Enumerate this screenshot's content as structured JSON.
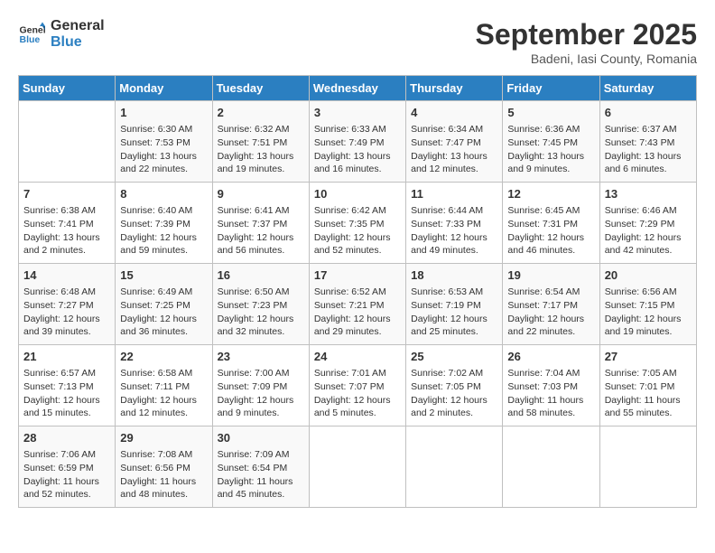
{
  "header": {
    "logo": {
      "line1": "General",
      "line2": "Blue"
    },
    "month": "September 2025",
    "location": "Badeni, Iasi County, Romania"
  },
  "weekdays": [
    "Sunday",
    "Monday",
    "Tuesday",
    "Wednesday",
    "Thursday",
    "Friday",
    "Saturday"
  ],
  "weeks": [
    [
      {
        "day": "",
        "info": ""
      },
      {
        "day": "1",
        "info": "Sunrise: 6:30 AM\nSunset: 7:53 PM\nDaylight: 13 hours\nand 22 minutes."
      },
      {
        "day": "2",
        "info": "Sunrise: 6:32 AM\nSunset: 7:51 PM\nDaylight: 13 hours\nand 19 minutes."
      },
      {
        "day": "3",
        "info": "Sunrise: 6:33 AM\nSunset: 7:49 PM\nDaylight: 13 hours\nand 16 minutes."
      },
      {
        "day": "4",
        "info": "Sunrise: 6:34 AM\nSunset: 7:47 PM\nDaylight: 13 hours\nand 12 minutes."
      },
      {
        "day": "5",
        "info": "Sunrise: 6:36 AM\nSunset: 7:45 PM\nDaylight: 13 hours\nand 9 minutes."
      },
      {
        "day": "6",
        "info": "Sunrise: 6:37 AM\nSunset: 7:43 PM\nDaylight: 13 hours\nand 6 minutes."
      }
    ],
    [
      {
        "day": "7",
        "info": "Sunrise: 6:38 AM\nSunset: 7:41 PM\nDaylight: 13 hours\nand 2 minutes."
      },
      {
        "day": "8",
        "info": "Sunrise: 6:40 AM\nSunset: 7:39 PM\nDaylight: 12 hours\nand 59 minutes."
      },
      {
        "day": "9",
        "info": "Sunrise: 6:41 AM\nSunset: 7:37 PM\nDaylight: 12 hours\nand 56 minutes."
      },
      {
        "day": "10",
        "info": "Sunrise: 6:42 AM\nSunset: 7:35 PM\nDaylight: 12 hours\nand 52 minutes."
      },
      {
        "day": "11",
        "info": "Sunrise: 6:44 AM\nSunset: 7:33 PM\nDaylight: 12 hours\nand 49 minutes."
      },
      {
        "day": "12",
        "info": "Sunrise: 6:45 AM\nSunset: 7:31 PM\nDaylight: 12 hours\nand 46 minutes."
      },
      {
        "day": "13",
        "info": "Sunrise: 6:46 AM\nSunset: 7:29 PM\nDaylight: 12 hours\nand 42 minutes."
      }
    ],
    [
      {
        "day": "14",
        "info": "Sunrise: 6:48 AM\nSunset: 7:27 PM\nDaylight: 12 hours\nand 39 minutes."
      },
      {
        "day": "15",
        "info": "Sunrise: 6:49 AM\nSunset: 7:25 PM\nDaylight: 12 hours\nand 36 minutes."
      },
      {
        "day": "16",
        "info": "Sunrise: 6:50 AM\nSunset: 7:23 PM\nDaylight: 12 hours\nand 32 minutes."
      },
      {
        "day": "17",
        "info": "Sunrise: 6:52 AM\nSunset: 7:21 PM\nDaylight: 12 hours\nand 29 minutes."
      },
      {
        "day": "18",
        "info": "Sunrise: 6:53 AM\nSunset: 7:19 PM\nDaylight: 12 hours\nand 25 minutes."
      },
      {
        "day": "19",
        "info": "Sunrise: 6:54 AM\nSunset: 7:17 PM\nDaylight: 12 hours\nand 22 minutes."
      },
      {
        "day": "20",
        "info": "Sunrise: 6:56 AM\nSunset: 7:15 PM\nDaylight: 12 hours\nand 19 minutes."
      }
    ],
    [
      {
        "day": "21",
        "info": "Sunrise: 6:57 AM\nSunset: 7:13 PM\nDaylight: 12 hours\nand 15 minutes."
      },
      {
        "day": "22",
        "info": "Sunrise: 6:58 AM\nSunset: 7:11 PM\nDaylight: 12 hours\nand 12 minutes."
      },
      {
        "day": "23",
        "info": "Sunrise: 7:00 AM\nSunset: 7:09 PM\nDaylight: 12 hours\nand 9 minutes."
      },
      {
        "day": "24",
        "info": "Sunrise: 7:01 AM\nSunset: 7:07 PM\nDaylight: 12 hours\nand 5 minutes."
      },
      {
        "day": "25",
        "info": "Sunrise: 7:02 AM\nSunset: 7:05 PM\nDaylight: 12 hours\nand 2 minutes."
      },
      {
        "day": "26",
        "info": "Sunrise: 7:04 AM\nSunset: 7:03 PM\nDaylight: 11 hours\nand 58 minutes."
      },
      {
        "day": "27",
        "info": "Sunrise: 7:05 AM\nSunset: 7:01 PM\nDaylight: 11 hours\nand 55 minutes."
      }
    ],
    [
      {
        "day": "28",
        "info": "Sunrise: 7:06 AM\nSunset: 6:59 PM\nDaylight: 11 hours\nand 52 minutes."
      },
      {
        "day": "29",
        "info": "Sunrise: 7:08 AM\nSunset: 6:56 PM\nDaylight: 11 hours\nand 48 minutes."
      },
      {
        "day": "30",
        "info": "Sunrise: 7:09 AM\nSunset: 6:54 PM\nDaylight: 11 hours\nand 45 minutes."
      },
      {
        "day": "",
        "info": ""
      },
      {
        "day": "",
        "info": ""
      },
      {
        "day": "",
        "info": ""
      },
      {
        "day": "",
        "info": ""
      }
    ]
  ]
}
